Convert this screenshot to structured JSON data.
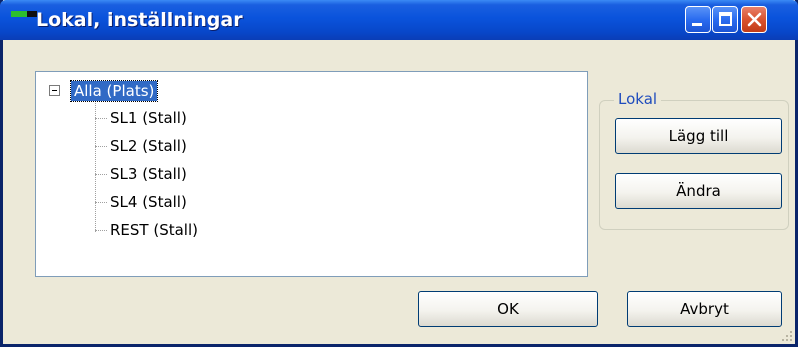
{
  "window": {
    "title": "Lokal, inställningar",
    "controls": [
      "minimize",
      "maximize",
      "close"
    ],
    "colors": {
      "title_bar": "#0a53dc",
      "background": "#ece9d8",
      "selection": "#316ac5",
      "group_label": "#1f4cbd"
    }
  },
  "tree": {
    "root": {
      "label": "Alla (Plats)",
      "expanded": true,
      "selected": true
    },
    "children": [
      "SL1 (Stall)",
      "SL2 (Stall)",
      "SL3 (Stall)",
      "SL4 (Stall)",
      "REST (Stall)"
    ]
  },
  "group": {
    "label": "Lokal",
    "add_label": "Lägg till",
    "edit_label": "Ändra"
  },
  "footer": {
    "ok_label": "OK",
    "cancel_label": "Avbryt"
  }
}
